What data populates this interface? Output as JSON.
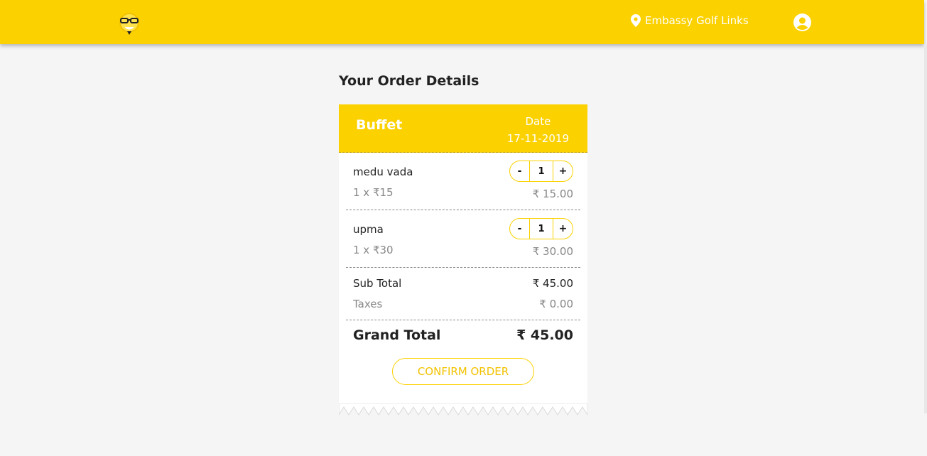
{
  "header": {
    "location": "Embassy Golf Links",
    "colors": {
      "accent": "#fcd100",
      "background": "#f5f5f5"
    }
  },
  "page": {
    "title": "Your Order Details"
  },
  "order": {
    "name": "Buffet",
    "date_label": "Date",
    "date": "17-11-2019",
    "items": [
      {
        "name": "medu vada",
        "unit": "1 x ₹15",
        "price": "₹ 15.00",
        "minus": "-",
        "qty": "1",
        "plus": "+"
      },
      {
        "name": "upma",
        "unit": "1 x ₹30",
        "price": "₹ 30.00",
        "minus": "-",
        "qty": "1",
        "plus": "+"
      }
    ],
    "subtotal_label": "Sub Total",
    "subtotal": "₹ 45.00",
    "taxes_label": "Taxes",
    "taxes": "₹ 0.00",
    "grand_total_label": "Grand Total",
    "grand_total": "₹ 45.00",
    "confirm_label": "CONFIRM ORDER"
  }
}
